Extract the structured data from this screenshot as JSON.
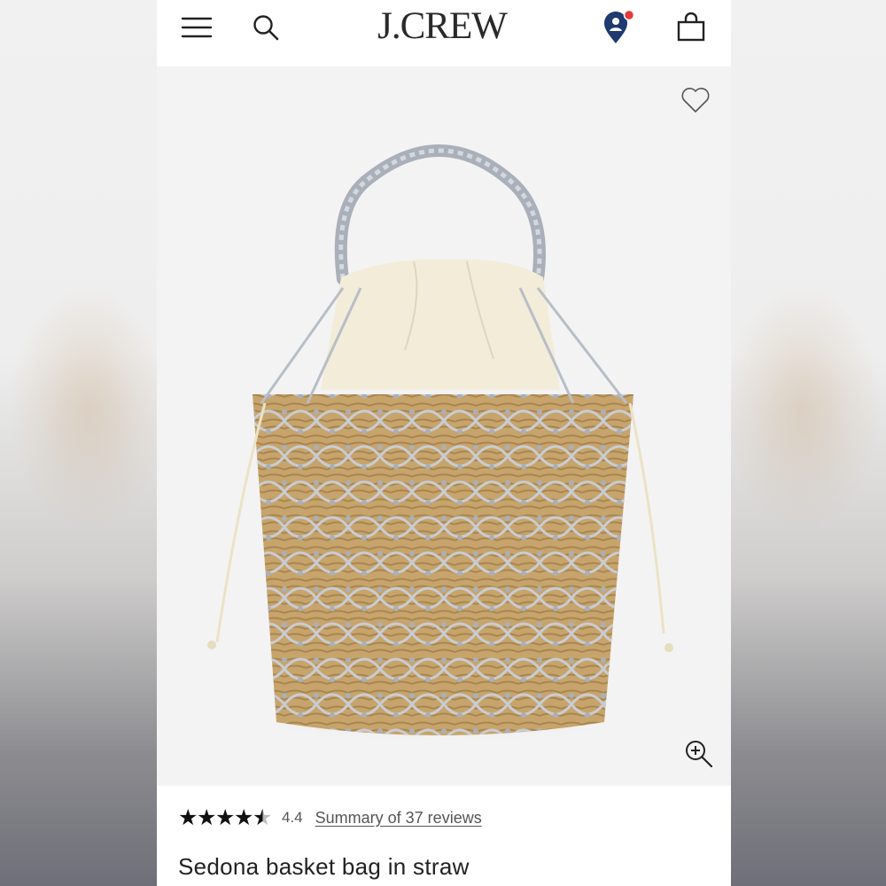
{
  "header": {
    "brand": "J.CREW",
    "menu_icon": "hamburger-menu-icon",
    "search_icon": "search-icon",
    "store_icon": "location-pin-icon",
    "bag_icon": "shopping-bag-icon",
    "notification_color": "#e23b3b",
    "pin_color": "#1e3a6e"
  },
  "product": {
    "image": "straw basket bag with silver net and cream drawstring",
    "favorite_icon": "heart-icon",
    "zoom_icon": "zoom-in-icon",
    "rating_stars": 4.4,
    "rating_value": "4.4",
    "reviews_link": "Summary of 37 reviews",
    "name": "Sedona basket bag in straw"
  }
}
